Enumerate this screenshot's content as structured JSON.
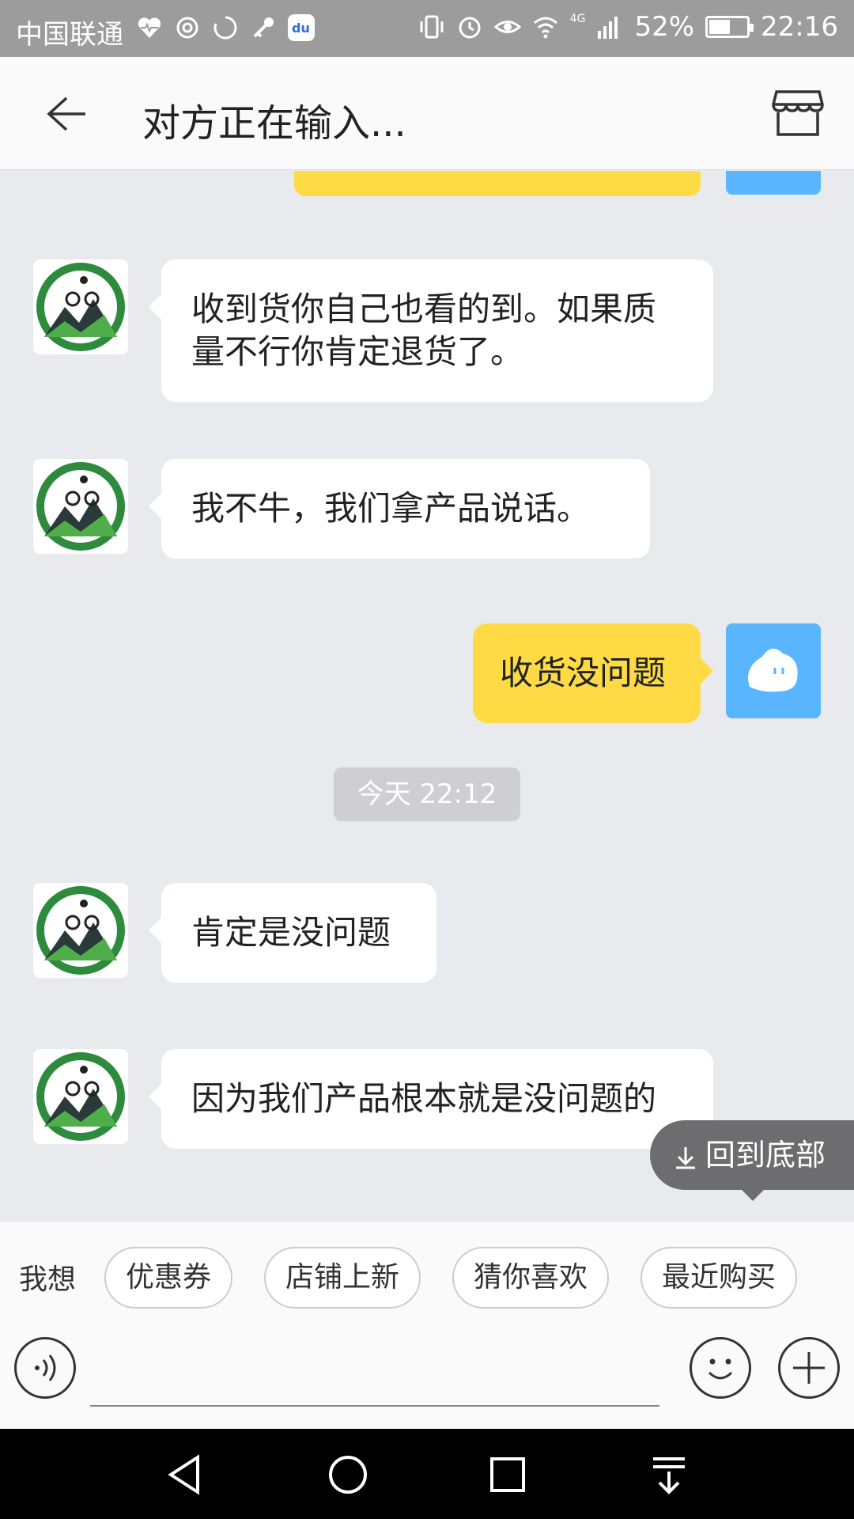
{
  "statusbar": {
    "carrier": "中国联通",
    "network": "4G",
    "battery": "52%",
    "time": "22:16"
  },
  "header": {
    "title": "对方正在输入..."
  },
  "messages": [
    {
      "side": "left",
      "text": "收到货你自己也看的到。如果质量不行你肯定退货了。"
    },
    {
      "side": "left",
      "text": "我不牛，我们拿产品说话。"
    },
    {
      "side": "right",
      "text": "收货没问题"
    },
    {
      "side": "left",
      "text": "肯定是没问题"
    },
    {
      "side": "left",
      "text": "因为我们产品根本就是没问题的"
    }
  ],
  "timestamp": "今天 22:12",
  "back_to_bottom": "回到底部",
  "quick": {
    "label": "我想",
    "chips": [
      "优惠券",
      "店铺上新",
      "猜你喜欢",
      "最近购买"
    ]
  },
  "input": {
    "placeholder": ""
  },
  "colors": {
    "self_bubble": "#fedb45",
    "self_avatar": "#5ab5ff",
    "background": "#e9eaee"
  }
}
